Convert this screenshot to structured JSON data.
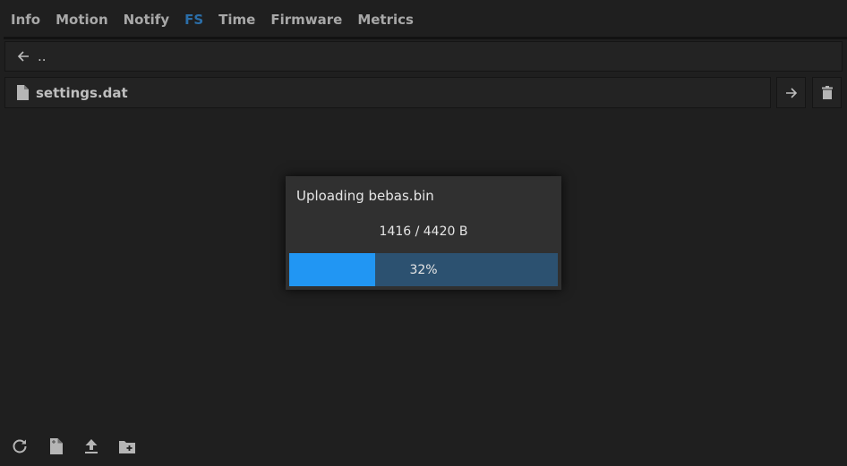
{
  "tabs": [
    {
      "label": "Info",
      "active": false
    },
    {
      "label": "Motion",
      "active": false
    },
    {
      "label": "Notify",
      "active": false
    },
    {
      "label": "FS",
      "active": true
    },
    {
      "label": "Time",
      "active": false
    },
    {
      "label": "Firmware",
      "active": false
    },
    {
      "label": "Metrics",
      "active": false
    }
  ],
  "file_browser": {
    "parent_dir": {
      "icon": "arrow-left-icon",
      "label": ".."
    },
    "files": [
      {
        "icon": "file-icon",
        "name": "settings.dat",
        "actions": [
          "arrow-right-icon",
          "trash-icon"
        ]
      }
    ]
  },
  "upload_dialog": {
    "title": "Uploading bebas.bin",
    "bytes_done": 1416,
    "bytes_total": 4420,
    "count_label": "1416 / 4420 B",
    "progress_percent": 32,
    "progress_label": "32%",
    "colors": {
      "fill": "#2196f3",
      "track": "#2c5170"
    }
  },
  "bottom_toolbar": [
    {
      "icon": "refresh-icon",
      "label": "Refresh"
    },
    {
      "icon": "new-file-icon",
      "label": "New file"
    },
    {
      "icon": "upload-icon",
      "label": "Upload"
    },
    {
      "icon": "new-folder-icon",
      "label": "New folder"
    }
  ],
  "colors": {
    "accent": "#1f5f99",
    "background": "#1f1f1f"
  }
}
